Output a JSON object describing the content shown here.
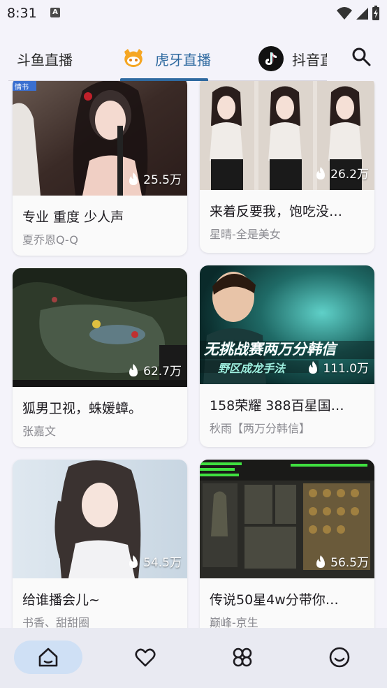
{
  "status_bar": {
    "time": "8:31",
    "notification_icon": "A"
  },
  "tabs": [
    {
      "label": "斗鱼直播",
      "active": false
    },
    {
      "label": "虎牙直播",
      "active": true
    },
    {
      "label": "抖音直播",
      "active": false
    }
  ],
  "cards": [
    {
      "title": "专业 重度 少人声",
      "anchor": "夏乔恩Q-Q",
      "views": "25.5万",
      "overlay_tag": "情书"
    },
    {
      "title": "来着反要我，饱吃没…",
      "anchor": "星晴-全是美女",
      "views": "26.2万"
    },
    {
      "title": "狐男卫视，蛛媛蟑。",
      "anchor": "张嘉文",
      "views": "62.7万"
    },
    {
      "title": "158荣耀 388百星国…",
      "anchor": "秋雨【两万分韩信】",
      "views": "111.0万",
      "overlay_text": "无挑战赛两万分韩信",
      "overlay_subtext": "野区成龙手法"
    },
    {
      "title": "给谁播会儿~",
      "anchor": "书香、甜甜圈",
      "views": "54.5万"
    },
    {
      "title": "传说50星4w分带你…",
      "anchor": "巅峰-京生",
      "views": "56.5万"
    }
  ],
  "bottom_nav": [
    {
      "icon": "home-icon",
      "active": true
    },
    {
      "icon": "heart-icon",
      "active": false
    },
    {
      "icon": "category-icon",
      "active": false
    },
    {
      "icon": "smile-icon",
      "active": false
    }
  ],
  "colors": {
    "accent": "#2f6aa0",
    "nav_active": "#cfe0f5",
    "background": "#f4f3fa"
  }
}
